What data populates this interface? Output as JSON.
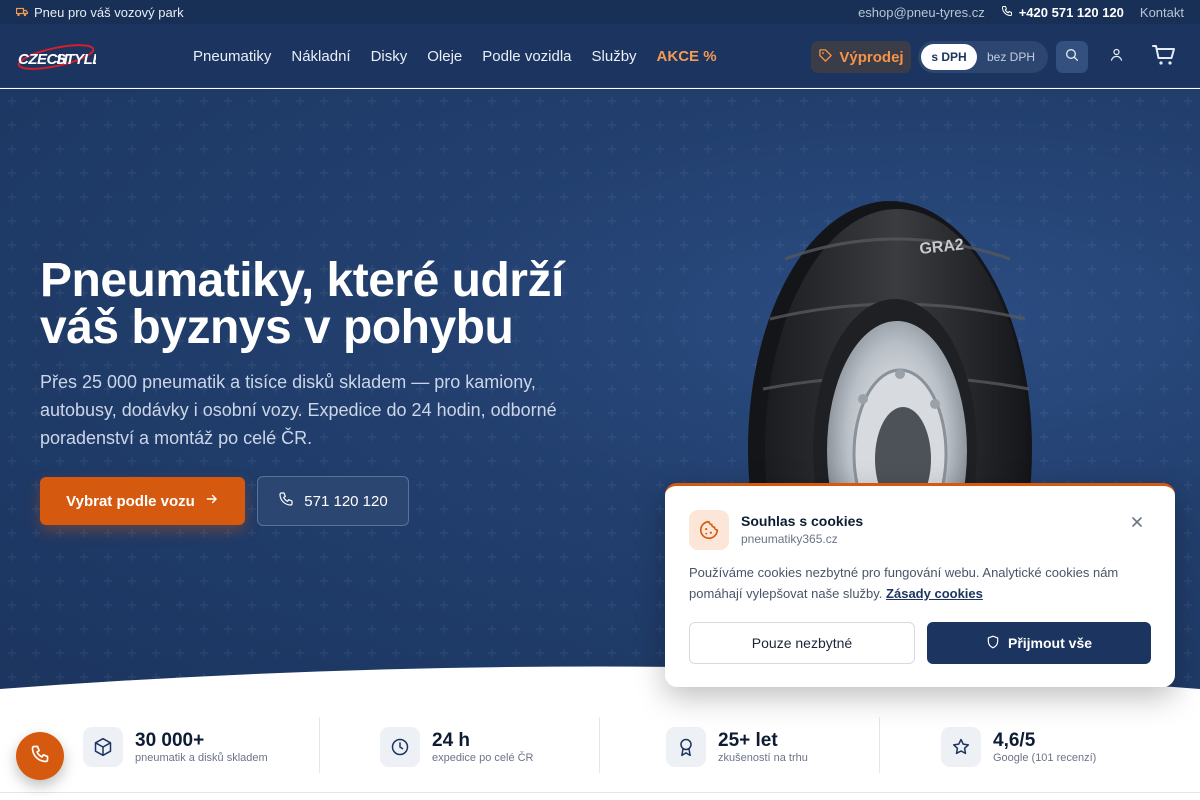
{
  "topbar": {
    "tagline": "Pneu pro váš vozový park",
    "email": "eshop@pneu-tyres.cz",
    "phone": "+420 571 120 120",
    "contact": "Kontakt"
  },
  "header": {
    "logo_text": "CZECH STYLE",
    "nav": [
      {
        "label": "Pneumatiky"
      },
      {
        "label": "Nákladní"
      },
      {
        "label": "Disky"
      },
      {
        "label": "Oleje"
      },
      {
        "label": "Podle vozidla"
      },
      {
        "label": "Služby"
      },
      {
        "label": "AKCE %"
      }
    ],
    "sale_label": "Výprodej",
    "vat_on": "s DPH",
    "vat_off": "bez DPH",
    "icons": [
      "search-icon",
      "user-icon",
      "cart-icon"
    ]
  },
  "hero": {
    "title": "Pneumatiky, které udrží váš byznys v pohybu",
    "lead": "Přes 25 000 pneumatik a tisíce disků skladem — pro kamiony, autobusy, dodávky i osobní vozy. Expedice do 24 hodin, odborné poradenství a montáž po celé ČR.",
    "cta_primary": "Vybrat podle vozu",
    "cta_phone": "571 120 120",
    "tyre_brand": "GRA2"
  },
  "stats": [
    {
      "value": "30 000+",
      "label": "pneumatik a disků skladem",
      "icon": "box-icon"
    },
    {
      "value": "24 h",
      "label": "expedice po celé ČR",
      "icon": "clock-icon"
    },
    {
      "value": "25+ let",
      "label": "zkušeností na trhu",
      "icon": "award-icon"
    },
    {
      "value": "4,6/5",
      "label": "Google (101 recenzí)",
      "icon": "star-icon"
    }
  ],
  "cookie": {
    "title": "Souhlas s cookies",
    "domain": "pneumatiky365.cz",
    "text": "Používáme cookies nezbytné pro fungování webu. Analytické cookies nám pomáhají vylepšovat naše služby.",
    "link": "Zásady cookies",
    "btn_necessary": "Pouze nezbytné",
    "btn_accept": "Přijmout vše"
  },
  "colors": {
    "navy": "#1c3560",
    "accent": "#d55a10",
    "sale": "#f59a52"
  }
}
